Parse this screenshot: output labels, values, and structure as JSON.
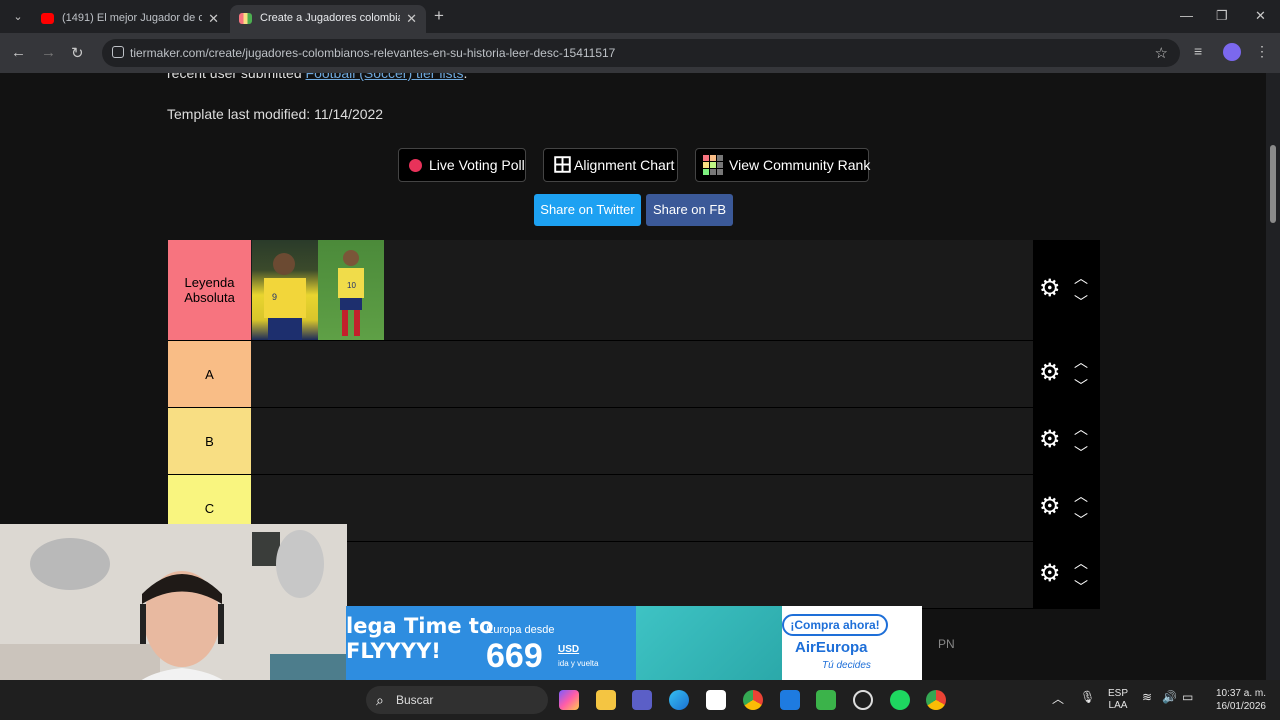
{
  "browser": {
    "tabs": [
      {
        "label": "(1491) El mejor Jugador de cada",
        "favicon_color": "#ff0000"
      },
      {
        "label": "Create a Jugadores colombiano",
        "favicon_color": "#4caf50"
      }
    ],
    "url": "tiermaker.com/create/jugadores-colombianos-relevantes-en-su-historia-leer-desc-15411517"
  },
  "page": {
    "clipped_prefix": "recent user submitted ",
    "clipped_link": "Football (Soccer) tier lists",
    "clipped_suffix": ".",
    "modified": "Template last modified: 11/14/2022",
    "buttons": {
      "live_poll": "Live Voting Poll",
      "alignment": "Alignment Chart",
      "community": "View Community Rank"
    },
    "share": {
      "twitter": "Share on Twitter",
      "fb": "Share on FB",
      "twitter_color": "#1da1f2",
      "fb_color": "#3b5998"
    }
  },
  "tiers": [
    {
      "label": "Leyenda Absoluta",
      "color": "#f7747f"
    },
    {
      "label": "A",
      "color": "#f9bd86"
    },
    {
      "label": "B",
      "color": "#f8de83"
    },
    {
      "label": "C",
      "color": "#f9f57f"
    },
    {
      "label": "",
      "color": "#bff784"
    }
  ],
  "ad": {
    "headline": "lega Time to\nFLYYYY!",
    "from": "Europa desde",
    "price": "669",
    "currency": "USD",
    "trip": "ida y vuelta",
    "cta": "¡Compra ahora!",
    "brand": "AirEuropa",
    "slogan": "Tú decides"
  },
  "overlay_text": "PN",
  "taskbar": {
    "search_placeholder": "Buscar",
    "lang_1": "ESP",
    "lang_2": "LAA",
    "time": "10:37 a. m.",
    "date": "16/01/2026"
  }
}
